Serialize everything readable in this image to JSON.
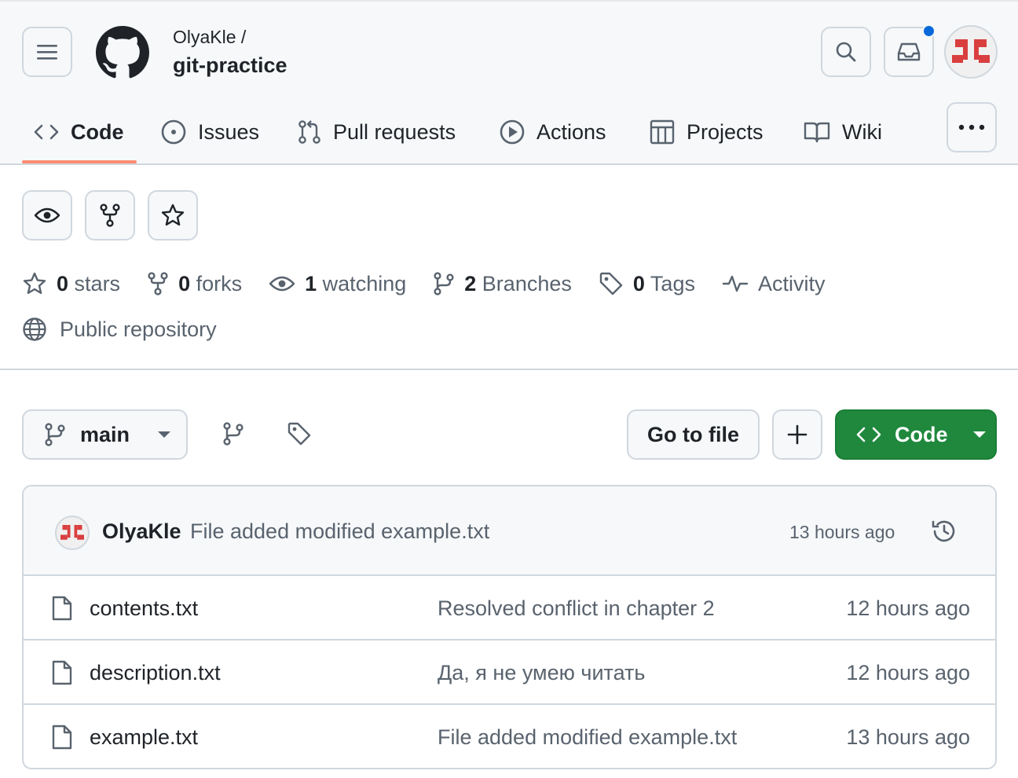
{
  "header": {
    "owner": "OlyaKle /",
    "repo_name": "git-practice",
    "icons": {
      "menu": "hamburger-menu-icon",
      "logo": "github-logo-icon",
      "search": "search-icon",
      "inbox": "inbox-icon",
      "avatar": "user-avatar"
    },
    "notification_color": "#0969da"
  },
  "nav": {
    "tabs": [
      {
        "label": "Code",
        "icon": "code-icon",
        "active": true
      },
      {
        "label": "Issues",
        "icon": "issue-opened-icon"
      },
      {
        "label": "Pull requests",
        "icon": "git-pull-request-icon"
      },
      {
        "label": "Actions",
        "icon": "play-icon"
      },
      {
        "label": "Projects",
        "icon": "table-icon"
      },
      {
        "label": "Wiki",
        "icon": "book-icon"
      }
    ],
    "active_underline_color": "#fd8c73",
    "more_icon": "kebab-horizontal-icon"
  },
  "repo_actions": {
    "icons": [
      "eye-icon",
      "repo-forked-icon",
      "star-icon"
    ]
  },
  "stats": {
    "stars_count": "0",
    "stars_label": "stars",
    "forks_count": "0",
    "forks_label": "forks",
    "watching_count": "1",
    "watching_label": "watching",
    "branches_count": "2",
    "branches_label": "Branches",
    "tags_count": "0",
    "tags_label": "Tags",
    "activity_label": "Activity",
    "visibility": "Public repository"
  },
  "toolbar": {
    "branch_name": "main",
    "goto_file_label": "Go to file",
    "code_button_label": "Code",
    "code_button_color": "#1f883d"
  },
  "latest_commit": {
    "author": "OlyaKle",
    "message": "File added modified example.txt",
    "time": "13 hours ago"
  },
  "files": [
    {
      "name": "contents.txt",
      "message": "Resolved conflict in chapter 2",
      "time": "12 hours ago"
    },
    {
      "name": "description.txt",
      "message": "Да, я не умею читать",
      "time": "12 hours ago"
    },
    {
      "name": "example.txt",
      "message": "File added modified example.txt",
      "time": "13 hours ago"
    }
  ]
}
